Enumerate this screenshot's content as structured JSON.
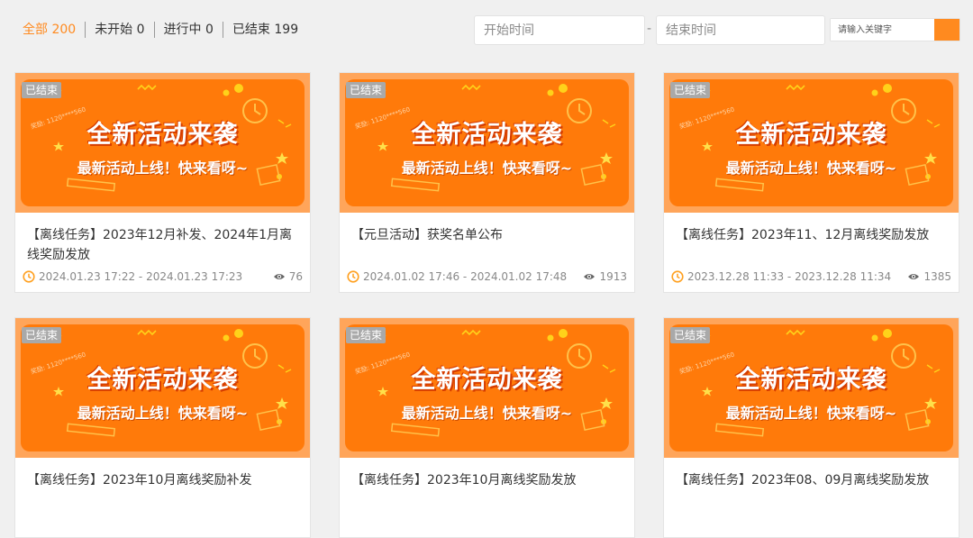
{
  "filters": [
    {
      "label": "全部",
      "count": "200",
      "active": true
    },
    {
      "label": "未开始",
      "count": "0",
      "active": false
    },
    {
      "label": "进行中",
      "count": "0",
      "active": false
    },
    {
      "label": "已结束",
      "count": "199",
      "active": false
    }
  ],
  "date_range": {
    "start_placeholder": "开始时间",
    "separator": "-",
    "end_placeholder": "结束时间"
  },
  "search": {
    "placeholder": "请输入关键字"
  },
  "banner": {
    "badge": "已结束",
    "headline": "全新活动来袭",
    "subline": "最新活动上线！快来看呀~"
  },
  "colors": {
    "accent": "#ff8a1f",
    "banner_orange": "#ff7a0a",
    "badge_gray": "#a9a9a9"
  },
  "cards": [
    {
      "title": "【离线任务】2023年12月补发、2024年1月离线奖励发放",
      "time": "2024.01.23 17:22 - 2024.01.23 17:23",
      "views": "76"
    },
    {
      "title": "【元旦活动】获奖名单公布",
      "time": "2024.01.02 17:46 - 2024.01.02 17:48",
      "views": "1913"
    },
    {
      "title": "【离线任务】2023年11、12月离线奖励发放",
      "time": "2023.12.28 11:33 - 2023.12.28 11:34",
      "views": "1385"
    },
    {
      "title": "【离线任务】2023年10月离线奖励补发",
      "time": "",
      "views": ""
    },
    {
      "title": "【离线任务】2023年10月离线奖励发放",
      "time": "",
      "views": ""
    },
    {
      "title": "【离线任务】2023年08、09月离线奖励发放",
      "time": "",
      "views": ""
    }
  ]
}
